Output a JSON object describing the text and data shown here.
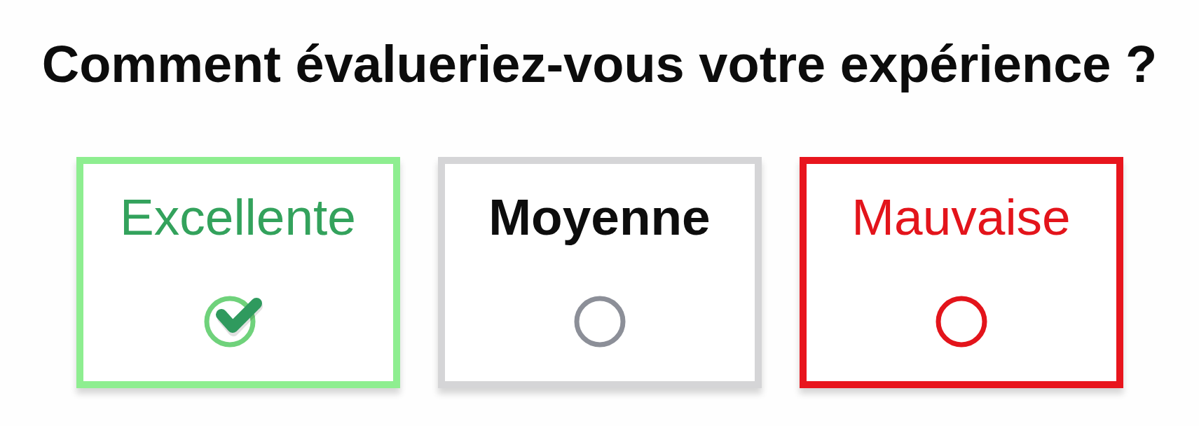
{
  "question": {
    "title": "Comment évalueriez-vous votre expérience ?"
  },
  "options": [
    {
      "label": "Excellente",
      "kind": "positive",
      "selected": true
    },
    {
      "label": "Moyenne",
      "kind": "neutral",
      "selected": false
    },
    {
      "label": "Mauvaise",
      "kind": "negative",
      "selected": false
    }
  ]
}
